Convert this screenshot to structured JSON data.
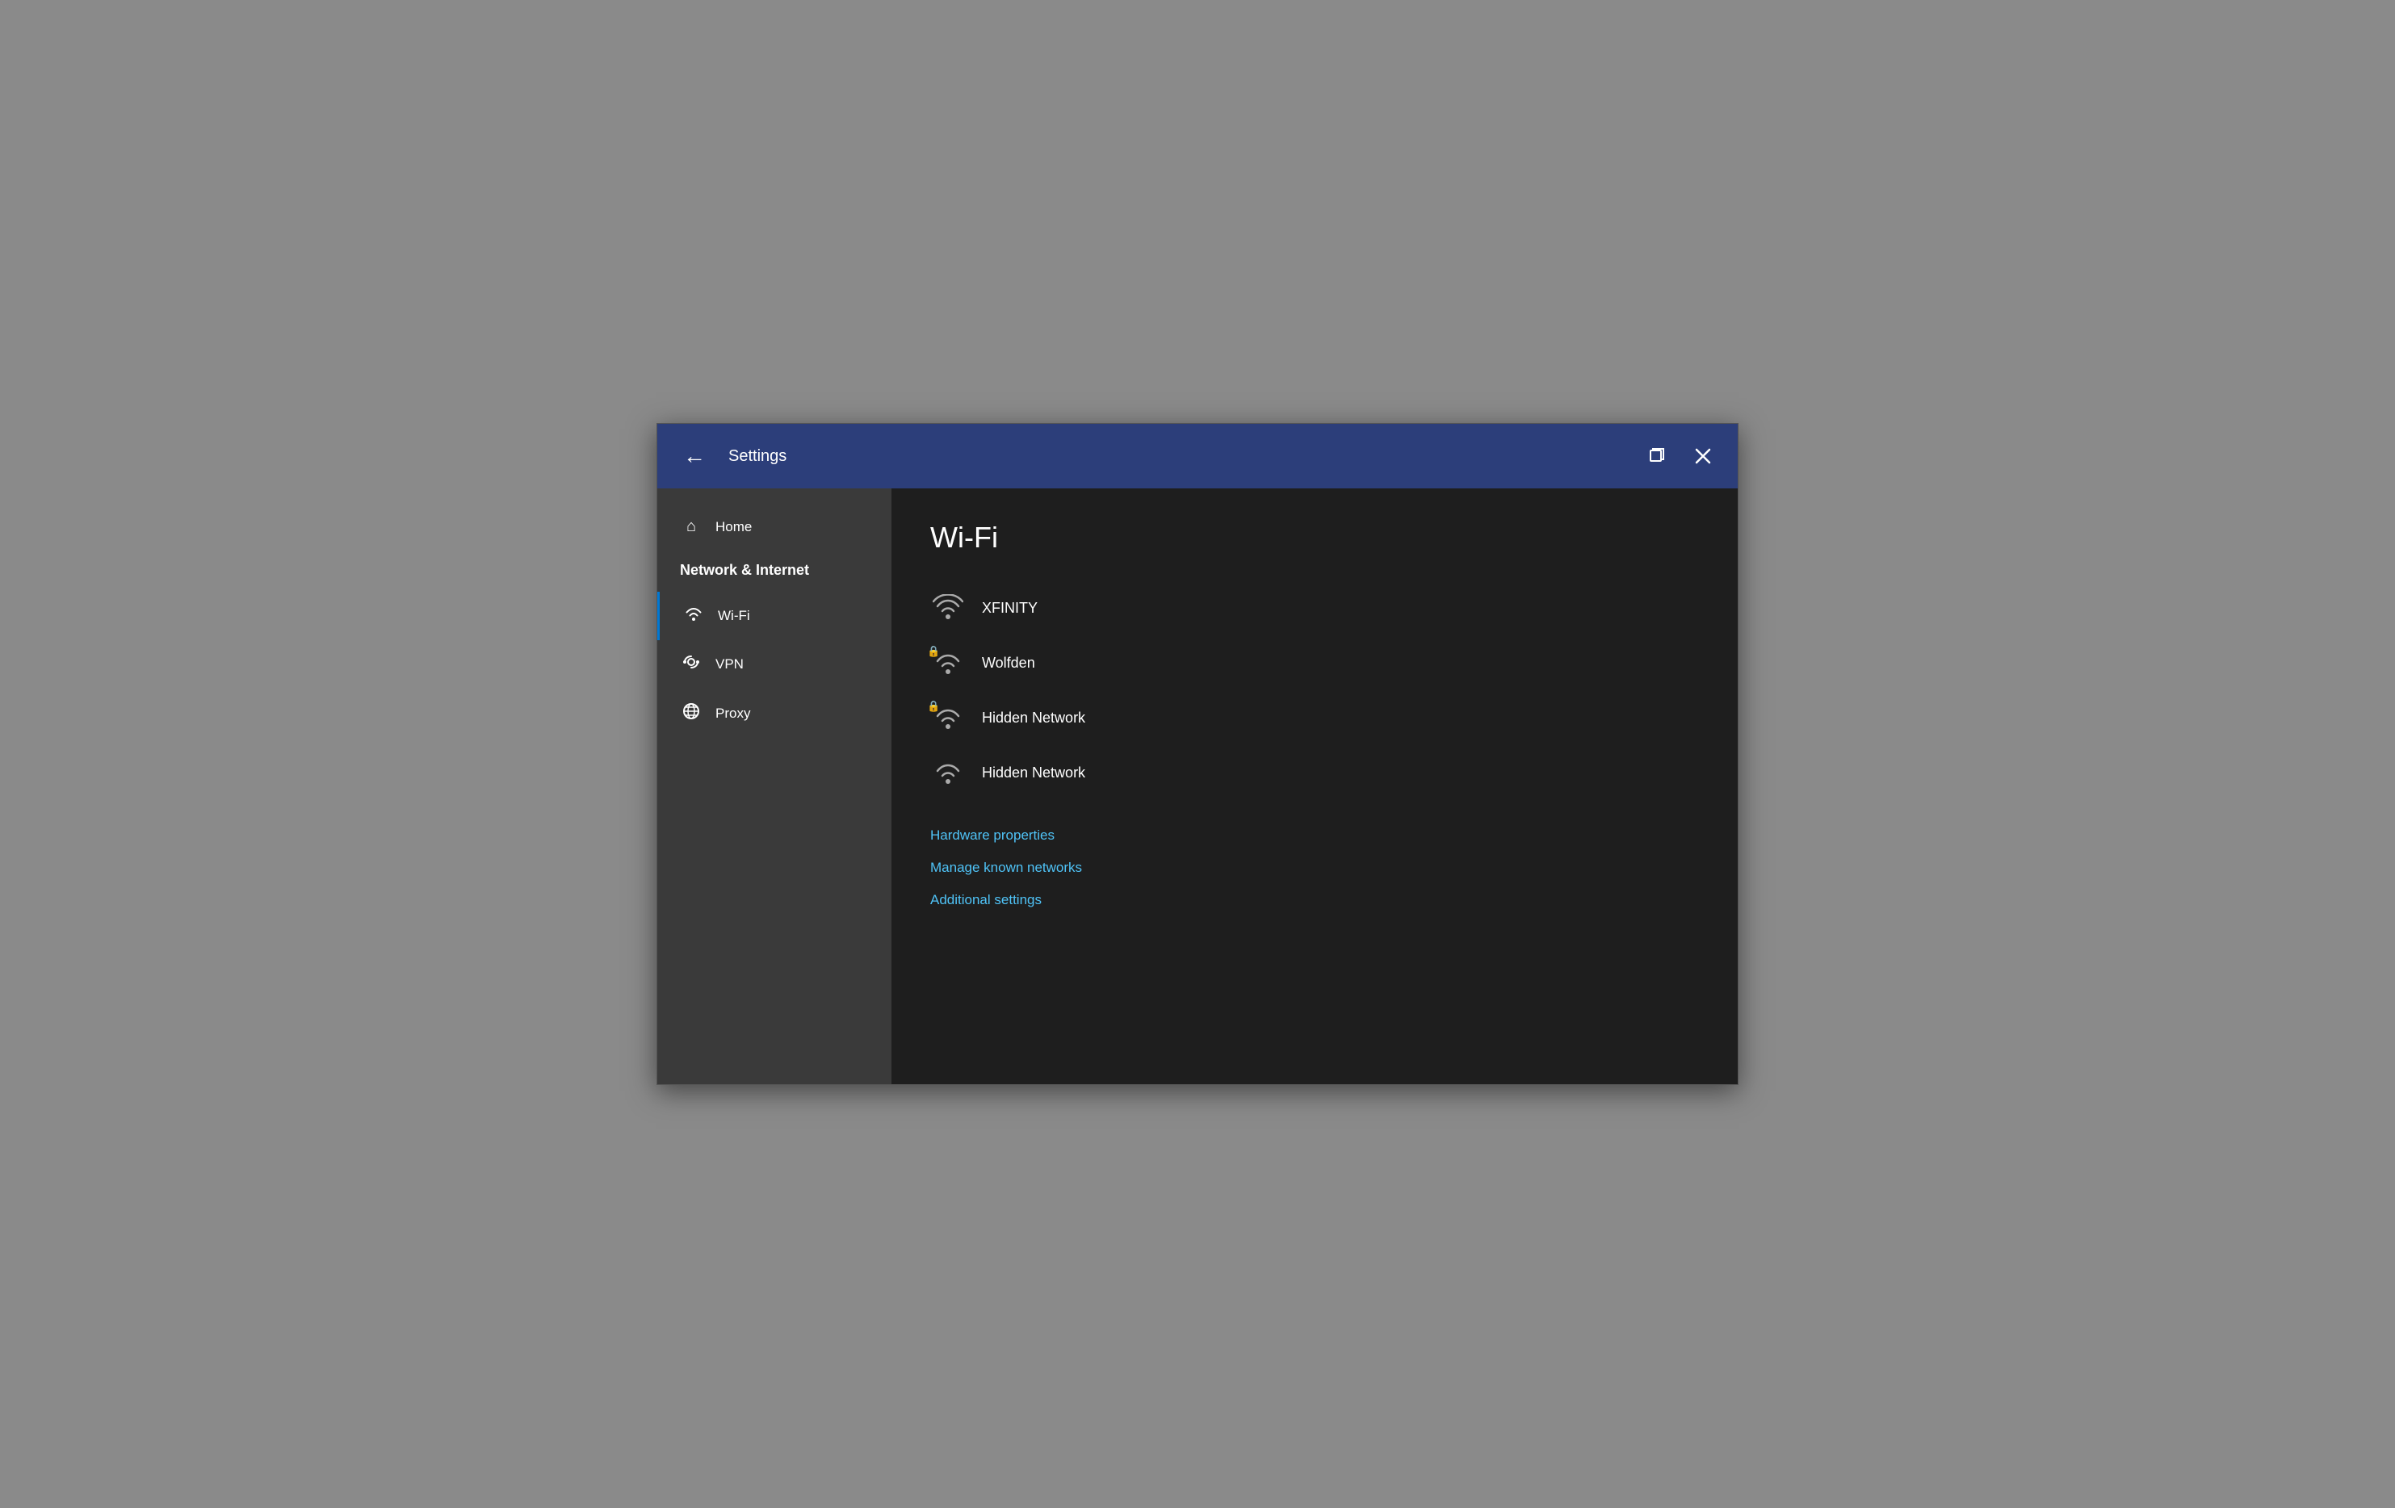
{
  "titlebar": {
    "back_label": "←",
    "title": "Settings",
    "restore_icon": "restore",
    "close_icon": "close"
  },
  "sidebar": {
    "home_label": "Home",
    "section_label": "Network & Internet",
    "items": [
      {
        "id": "wifi",
        "label": "Wi-Fi",
        "icon": "wifi",
        "active": true
      },
      {
        "id": "vpn",
        "label": "VPN",
        "icon": "vpn",
        "active": false
      },
      {
        "id": "proxy",
        "label": "Proxy",
        "icon": "proxy",
        "active": false
      }
    ]
  },
  "main": {
    "page_title": "Wi-Fi",
    "networks": [
      {
        "id": "xfinity",
        "name": "XFINITY",
        "secured": false
      },
      {
        "id": "wolfden",
        "name": "Wolfden",
        "secured": true
      },
      {
        "id": "hidden1",
        "name": "Hidden Network",
        "secured": true
      },
      {
        "id": "hidden2",
        "name": "Hidden Network",
        "secured": false
      }
    ],
    "links": [
      {
        "id": "hardware",
        "label": "Hardware properties"
      },
      {
        "id": "manage",
        "label": "Manage known networks"
      },
      {
        "id": "additional",
        "label": "Additional settings"
      }
    ]
  }
}
